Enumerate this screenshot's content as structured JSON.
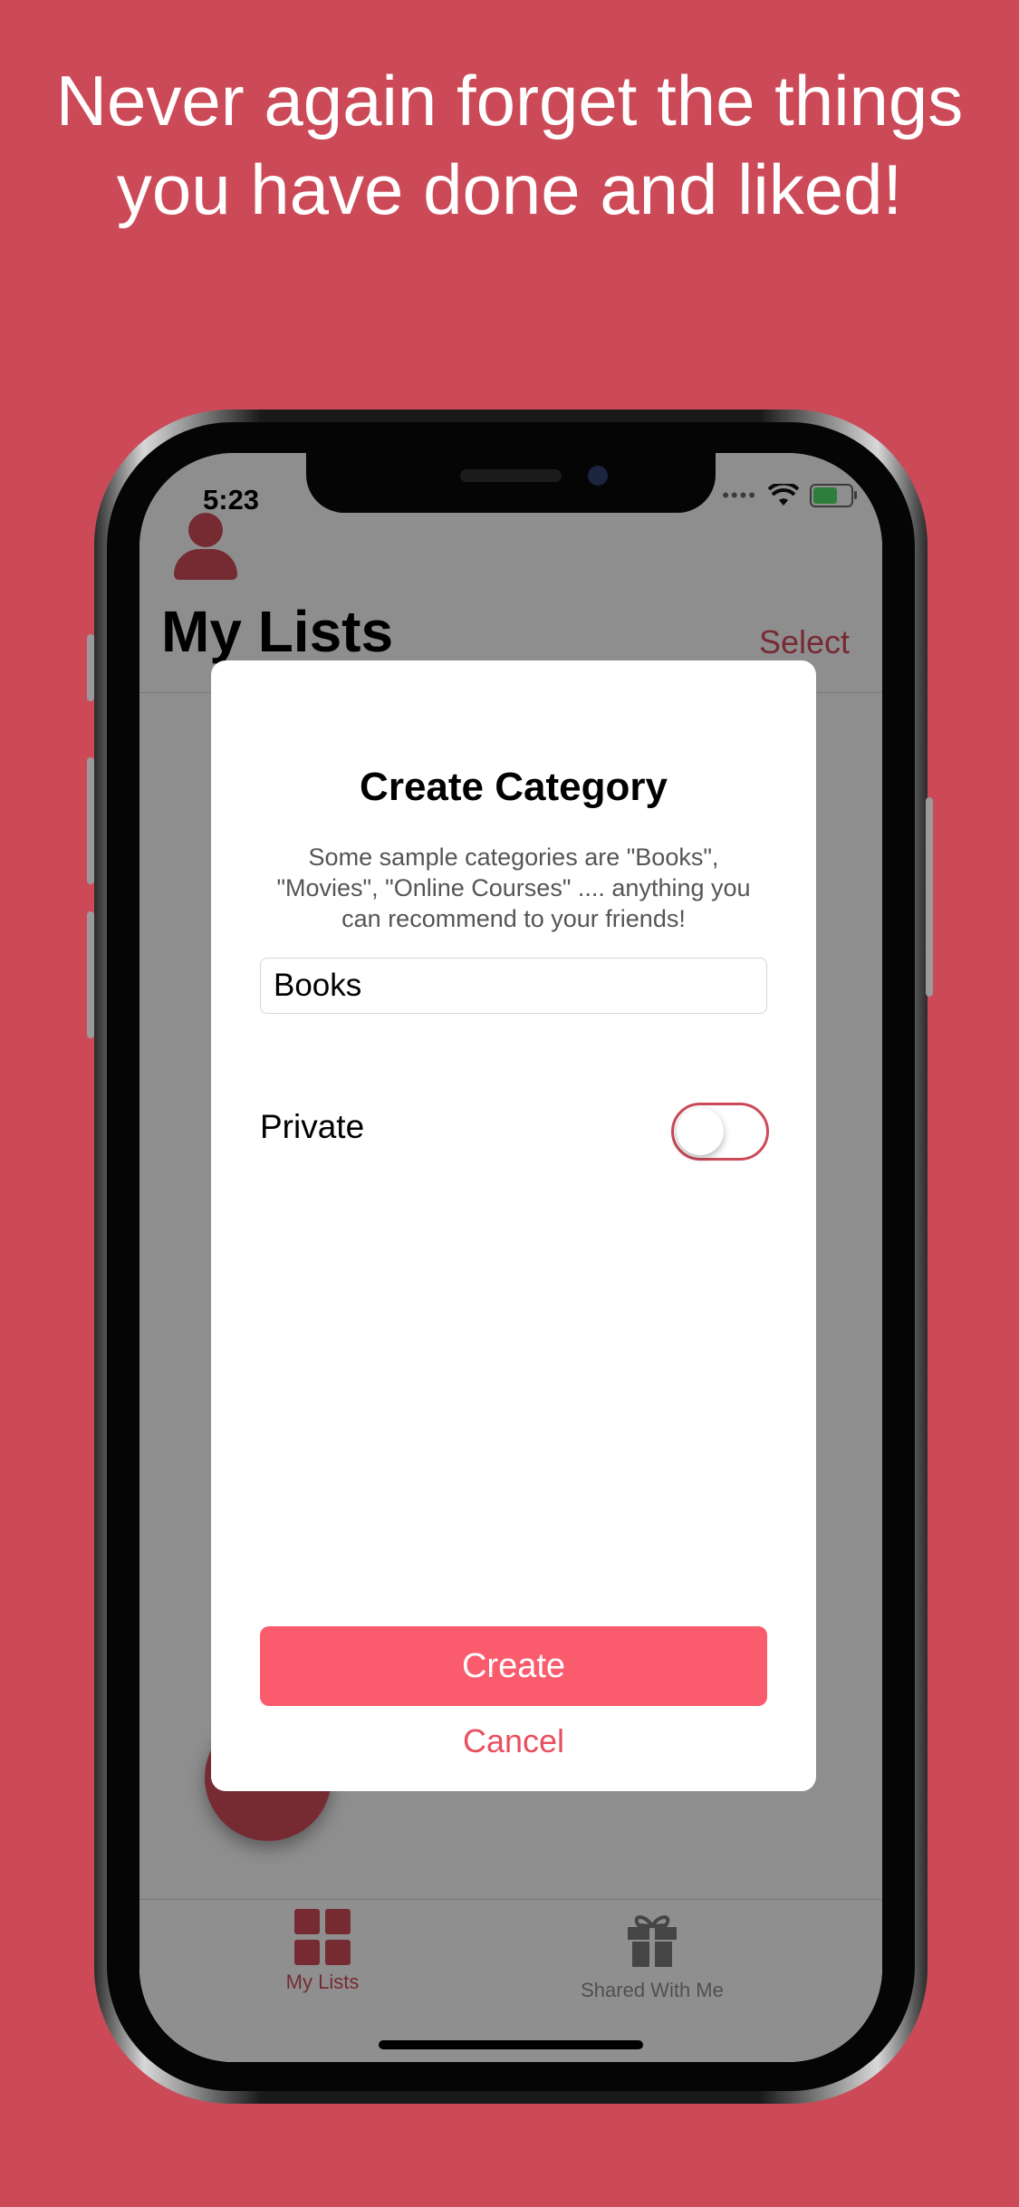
{
  "headline": "Never again forget the things you have done and liked!",
  "colors": {
    "background": "#cc4a58",
    "accent": "#cc4a58",
    "button": "#fa5c6d",
    "text": "#000000"
  },
  "status_bar": {
    "time": "5:23"
  },
  "nav": {
    "title": "My Lists",
    "select_label": "Select"
  },
  "modal": {
    "title": "Create Category",
    "description": "Some sample categories are \"Books\", \"Movies\", \"Online Courses\" .... anything you can recommend to your friends!",
    "input_value": "Books",
    "private_label": "Private",
    "private_enabled": false,
    "create_label": "Create",
    "cancel_label": "Cancel"
  },
  "tabbar": {
    "items": [
      {
        "label": "My Lists",
        "icon": "grid-icon",
        "selected": true
      },
      {
        "label": "Shared With Me",
        "icon": "gift-icon",
        "selected": false
      }
    ]
  }
}
